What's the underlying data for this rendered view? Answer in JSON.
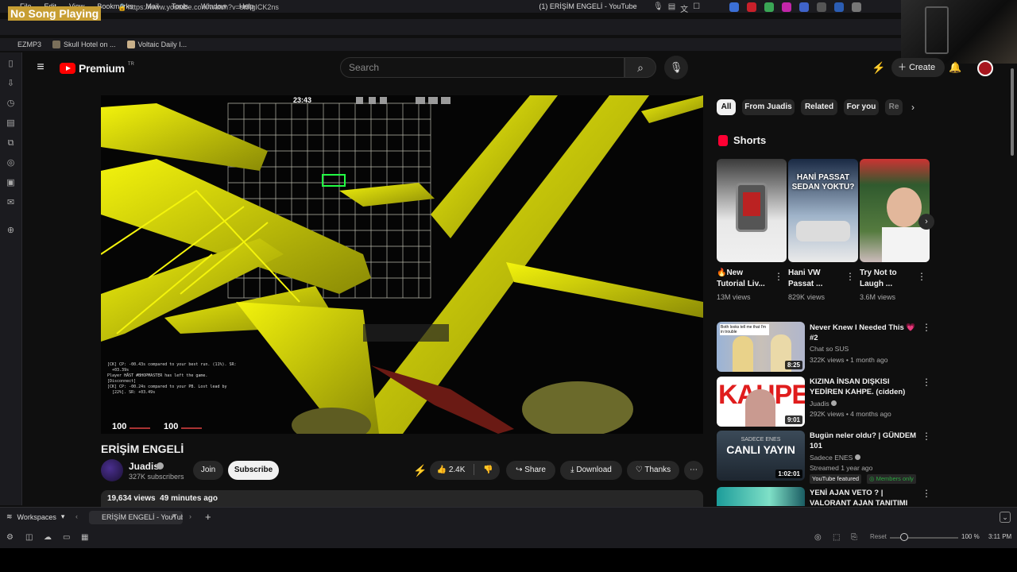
{
  "os_menu": {
    "items": [
      "File",
      "Edit",
      "View",
      "Bookmarks",
      "Mail",
      "Tools",
      "Window",
      "Help"
    ],
    "window_title": "(1) ERİŞİM ENGELİ - YouTube"
  },
  "overlay": {
    "now_playing": "No Song Playing"
  },
  "address": {
    "url": "https://www.youtube.com/watch?v=st9IgICK2ns"
  },
  "bookmarks": [
    "EZMP3",
    "Skull Hotel on ...",
    "Voltaic Daily I..."
  ],
  "youtube": {
    "logo_text": "Premium",
    "logo_sup": "TR",
    "search_placeholder": "Search",
    "create_label": "Create"
  },
  "video": {
    "hud_timer": "23:43",
    "hud_health": "100",
    "hud_armor": "100",
    "title": "ERİŞİM ENGELİ",
    "channel": "Juadis",
    "subscribers": "327K subscribers",
    "join_label": "Join",
    "subscribe_label": "Subscribe",
    "likes": "2.4K",
    "share_label": "Share",
    "download_label": "Download",
    "thanks_label": "Thanks",
    "views": "19,634 views",
    "age": "49 minutes ago"
  },
  "chips": [
    "All",
    "From Juadis",
    "Related",
    "For you",
    "Re"
  ],
  "shorts": {
    "heading": "Shorts",
    "items": [
      {
        "title": "🔥New\nTutorial Liv...",
        "views": "13M views",
        "overlay": ""
      },
      {
        "title": "Hani VW\nPassat ...",
        "views": "829K views",
        "overlay": "HANİ PASSAT\nSEDAN YOKTU?"
      },
      {
        "title": "Try Not to\nLaugh ...",
        "views": "3.6M views",
        "overlay": ""
      }
    ]
  },
  "recommendations": [
    {
      "title": "Never Knew I Needed This 💗 #2",
      "channel": "Chat so SUS",
      "meta": "322K views • 1 month ago",
      "duration": "8:25",
      "thumb_text": "Both looks tell me that I'm in trouble"
    },
    {
      "title": "KIZINA İNSAN DIŞKISI YEDİREN KAHPE. (cidden)",
      "channel": "Juadis",
      "meta": "292K views • 4 months ago",
      "duration": "9:01",
      "thumb_text": "KAHPE"
    },
    {
      "title": "Bugün neler oldu? | GÜNDEM 101",
      "channel": "Sadece ENES",
      "meta": "Streamed 1 year ago",
      "duration": "1:02:01",
      "thumb_text": "CANLI YAYIN",
      "thumb_sub": "SADECE ENES",
      "badge_featured": "YouTube featured",
      "badge_members": "Members only"
    },
    {
      "title": "YENİ AJAN VETO ? | VALORANT AJAN TANITIMI",
      "channel": "",
      "meta": "",
      "duration": "",
      "thumb_text": ""
    }
  ],
  "tabbar": {
    "workspaces_label": "Workspaces",
    "tab_title": "ERİŞİM ENGELİ - YouTube"
  },
  "statusbar": {
    "reset_label": "Reset",
    "zoom": "100 %",
    "clock": "3:11 PM"
  },
  "colors": {
    "yt_red": "#ff0000",
    "neon": "#f2f20a",
    "bg": "#0f0f0f",
    "now_playing_bg": "#c79e33",
    "members_green": "#2ba640"
  }
}
